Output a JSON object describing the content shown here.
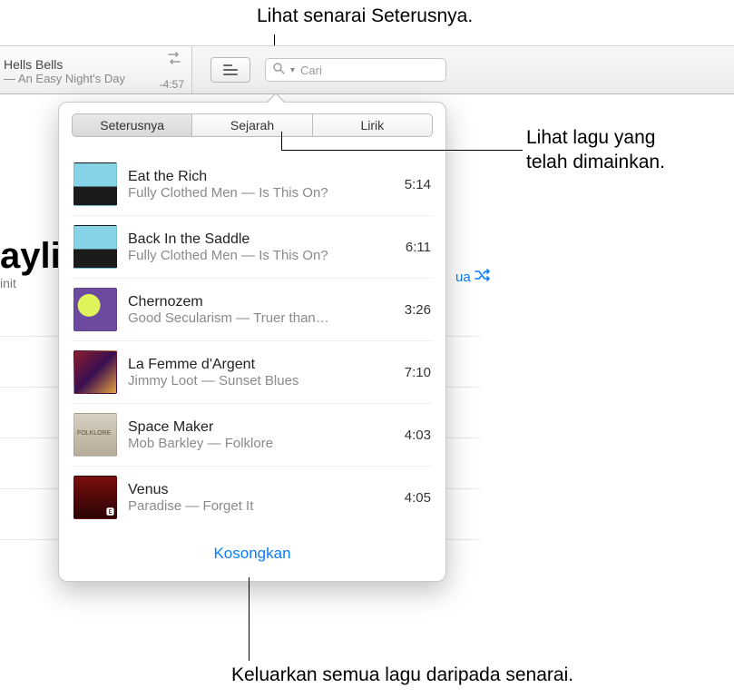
{
  "callouts": {
    "top": "Lihat senarai Seterusnya.",
    "right1_l1": "Lihat lagu yang",
    "right1_l2": "telah dimainkan.",
    "bottom": "Keluarkan semua lagu daripada senarai."
  },
  "nowPlaying": {
    "title": "Hells Bells",
    "subtitle": " — An Easy Night's Day",
    "remaining": "-4:57"
  },
  "search": {
    "placeholder": "Cari"
  },
  "tabs": {
    "next": "Seterusnya",
    "history": "Sejarah",
    "lyrics": "Lirik"
  },
  "bg": {
    "aylist": "aylis",
    "init": "init",
    "ua": "ua"
  },
  "queue": [
    {
      "title": "Eat the Rich",
      "sub": "Fully Clothed Men — Is This On?",
      "dur": "5:14",
      "art": "art1"
    },
    {
      "title": "Back In the Saddle",
      "sub": "Fully Clothed Men — Is This On?",
      "dur": "6:11",
      "art": "art1"
    },
    {
      "title": "Chernozem",
      "sub": "Good Secularism — Truer than…",
      "dur": "3:26",
      "art": "art2"
    },
    {
      "title": "La Femme d'Argent",
      "sub": "Jimmy Loot — Sunset Blues",
      "dur": "7:10",
      "art": "art3"
    },
    {
      "title": "Space Maker",
      "sub": "Mob Barkley — Folklore",
      "dur": "4:03",
      "art": "art4"
    },
    {
      "title": "Venus",
      "sub": "Paradise — Forget It",
      "dur": "4:05",
      "art": "art5"
    }
  ],
  "clear": "Kosongkan"
}
